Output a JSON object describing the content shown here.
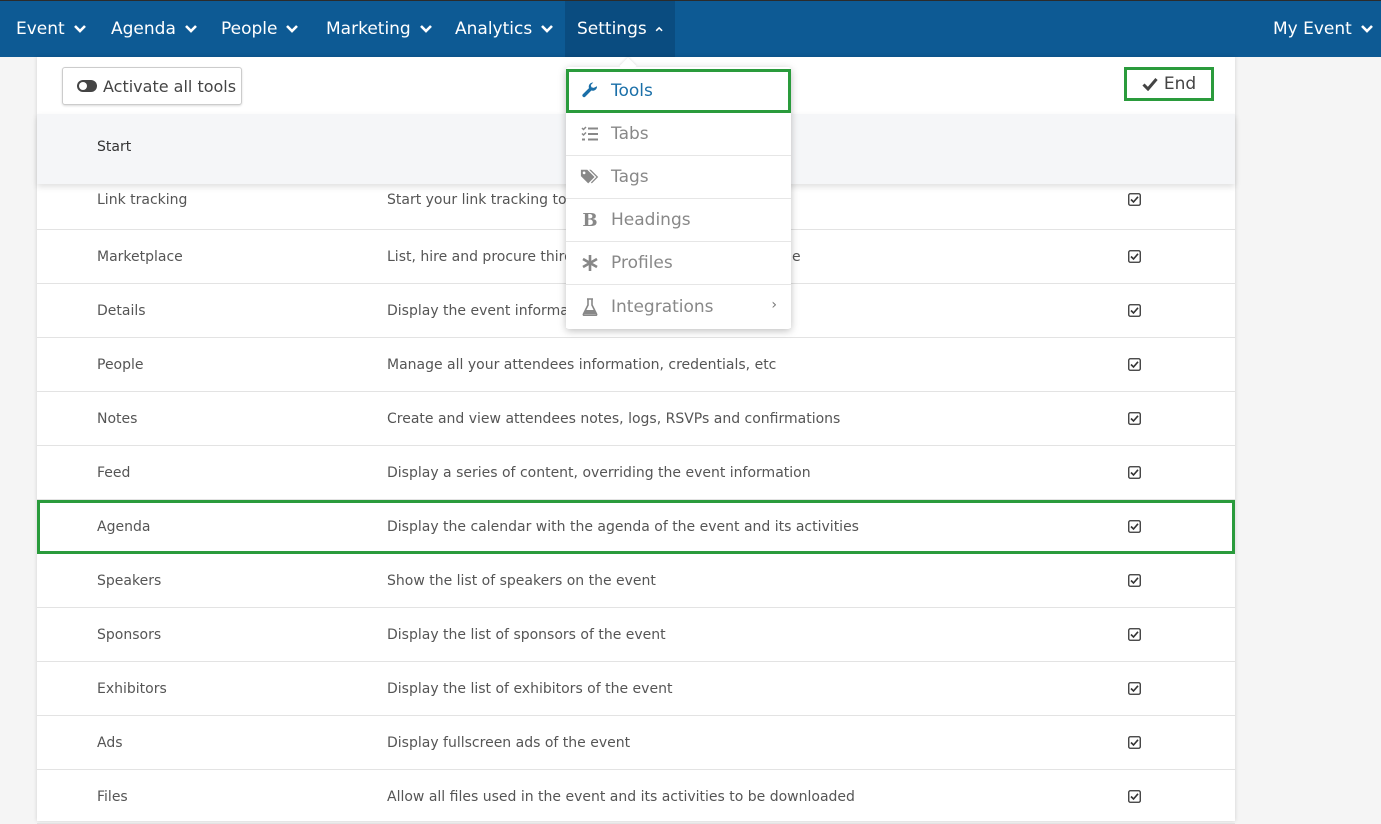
{
  "nav": {
    "items": [
      {
        "label": "Event"
      },
      {
        "label": "Agenda"
      },
      {
        "label": "People"
      },
      {
        "label": "Marketing"
      },
      {
        "label": "Analytics"
      },
      {
        "label": "Settings"
      }
    ],
    "right_label": "My Event",
    "active": "Settings",
    "colors": {
      "bar": "#0d5a94",
      "active": "#0a4c80",
      "highlight": "#2a9b3c",
      "link": "#1a6fa8"
    }
  },
  "toolbar": {
    "activate_label": "Activate all tools",
    "end_label": "End"
  },
  "table": {
    "header": "Start",
    "rows": [
      {
        "name": "Link tracking",
        "desc": "Start your link tracking tool",
        "checked": true
      },
      {
        "name": "Marketplace",
        "desc": "List, hire and procure third",
        "desc_tail": "e",
        "checked": true
      },
      {
        "name": "Details",
        "desc": "Display the event informati",
        "checked": true
      },
      {
        "name": "People",
        "desc": "Manage all your attendees information, credentials, etc",
        "checked": true
      },
      {
        "name": "Notes",
        "desc": "Create and view attendees notes, logs, RSVPs and confirmations",
        "checked": true
      },
      {
        "name": "Feed",
        "desc": "Display a series of content, overriding the event information",
        "checked": true
      },
      {
        "name": "Agenda",
        "desc": "Display the calendar with the agenda of the event and its activities",
        "checked": true,
        "highlighted": true
      },
      {
        "name": "Speakers",
        "desc": "Show the list of speakers on the event",
        "checked": true
      },
      {
        "name": "Sponsors",
        "desc": "Display the list of sponsors of the event",
        "checked": true
      },
      {
        "name": "Exhibitors",
        "desc": "Display the list of exhibitors of the event",
        "checked": true
      },
      {
        "name": "Ads",
        "desc": "Display fullscreen ads of the event",
        "checked": true
      },
      {
        "name": "Files",
        "desc": "Allow all files used in the event and its activities to be downloaded",
        "checked": true
      }
    ]
  },
  "dropdown": {
    "items": [
      {
        "label": "Tools",
        "icon": "wrench-icon",
        "selected": true
      },
      {
        "label": "Tabs",
        "icon": "list-check-icon"
      },
      {
        "label": "Tags",
        "icon": "tags-icon"
      },
      {
        "label": "Headings",
        "icon": "bold-icon"
      },
      {
        "label": "Profiles",
        "icon": "asterisk-icon"
      },
      {
        "label": "Integrations",
        "icon": "flask-icon",
        "has_submenu": true
      }
    ]
  }
}
